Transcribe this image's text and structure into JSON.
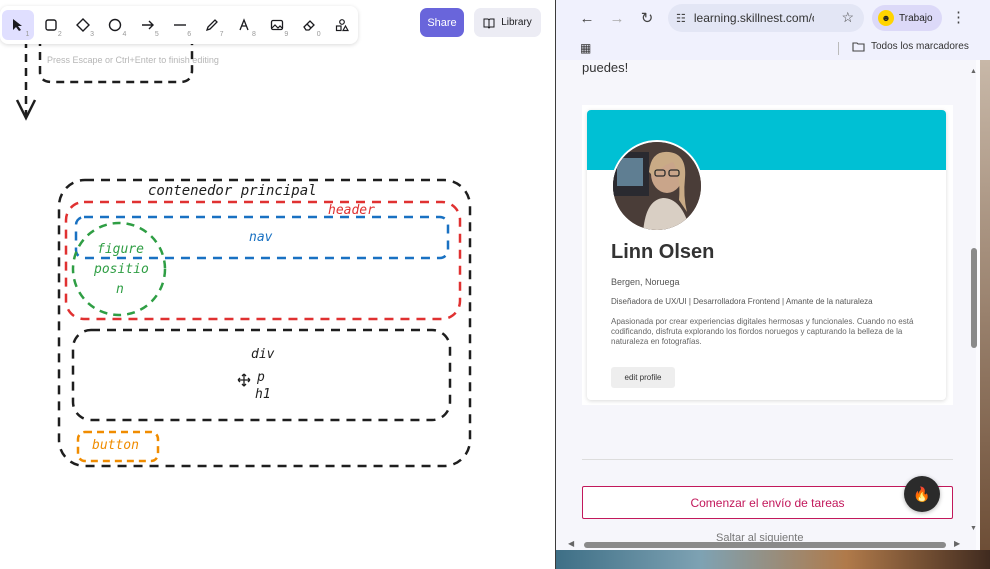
{
  "whiteboard": {
    "toolbar": {
      "tools": [
        {
          "name": "selection",
          "key": "1"
        },
        {
          "name": "rectangle",
          "key": "2"
        },
        {
          "name": "diamond",
          "key": "3"
        },
        {
          "name": "ellipse",
          "key": "4"
        },
        {
          "name": "arrow",
          "key": "5"
        },
        {
          "name": "line",
          "key": "6"
        },
        {
          "name": "draw",
          "key": "7"
        },
        {
          "name": "text",
          "key": "8"
        },
        {
          "name": "image",
          "key": "9"
        },
        {
          "name": "eraser",
          "key": "0"
        }
      ],
      "share_label": "Share",
      "library_label": "Library"
    },
    "hint": "Press Escape or Ctrl+Enter to finish editing",
    "labels": {
      "contenedor": "contenedor principal",
      "header": "header",
      "nav": "nav",
      "figure_1": "figure",
      "figure_2": "positio",
      "figure_3": "n",
      "div": "div",
      "p": "p",
      "h1": "h1",
      "button": "button"
    },
    "colors": {
      "accent": "#6965db",
      "black_stroke": "#1e1e1e",
      "red_stroke": "#e03131",
      "blue_stroke": "#1971c2",
      "green_stroke": "#2f9e44",
      "orange_stroke": "#f08c00"
    }
  },
  "browser": {
    "url": "learning.skillnest.com/c...",
    "profile_label": "Trabajo",
    "bookmarks_label": "Todos los marcadores",
    "page": {
      "intro_text": "puedes!",
      "card": {
        "name": "Linn Olsen",
        "location": "Bergen, Noruega",
        "role": "Diseñadora de UX/UI | Desarrolladora Frontend | Amante de la naturaleza",
        "bio": "Apasionada por crear experiencias digitales hermosas y funcionales. Cuando no está codificando, disfruta explorando los fiordos noruegos y capturando la belleza de la naturaleza en fotografías.",
        "edit_label": "edit profile",
        "banner_color": "#00c0d4"
      },
      "cta_label": "Comenzar el envío de tareas",
      "next_label": "Saltar al siguiente",
      "cta_color": "#c2185b"
    }
  }
}
